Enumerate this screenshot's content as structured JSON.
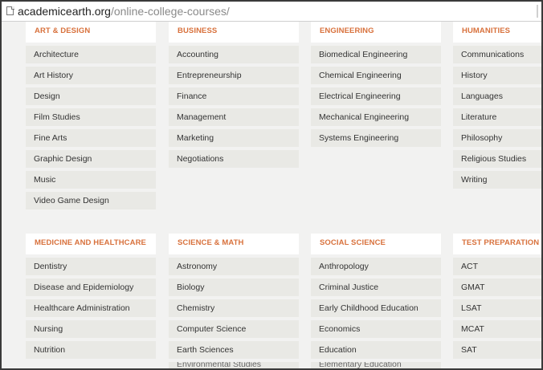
{
  "url": {
    "domain": "academicearth.org",
    "path": "/online-college-courses/"
  },
  "rows": [
    [
      {
        "title": "ART & DESIGN",
        "items": [
          "Architecture",
          "Art History",
          "Design",
          "Film Studies",
          "Fine Arts",
          "Graphic Design",
          "Music",
          "Video Game Design"
        ]
      },
      {
        "title": "BUSINESS",
        "items": [
          "Accounting",
          "Entrepreneurship",
          "Finance",
          "Management",
          "Marketing",
          "Negotiations"
        ]
      },
      {
        "title": "ENGINEERING",
        "items": [
          "Biomedical Engineering",
          "Chemical Engineering",
          "Electrical Engineering",
          "Mechanical Engineering",
          "Systems Engineering"
        ]
      },
      {
        "title": "HUMANITIES",
        "items": [
          "Communications",
          "History",
          "Languages",
          "Literature",
          "Philosophy",
          "Religious Studies",
          "Writing"
        ]
      }
    ],
    [
      {
        "title": "MEDICINE AND HEALTHCARE",
        "items": [
          "Dentistry",
          "Disease and Epidemiology",
          "Healthcare Administration",
          "Nursing",
          "Nutrition"
        ]
      },
      {
        "title": "SCIENCE & MATH",
        "items": [
          "Astronomy",
          "Biology",
          "Chemistry",
          "Computer Science",
          "Earth Sciences",
          "Environmental Studies"
        ]
      },
      {
        "title": "SOCIAL SCIENCE",
        "items": [
          "Anthropology",
          "Criminal Justice",
          "Early Childhood Education",
          "Economics",
          "Education",
          "Elementary Education"
        ]
      },
      {
        "title": "TEST PREPARATION",
        "items": [
          "ACT",
          "GMAT",
          "LSAT",
          "MCAT",
          "SAT"
        ]
      }
    ]
  ]
}
